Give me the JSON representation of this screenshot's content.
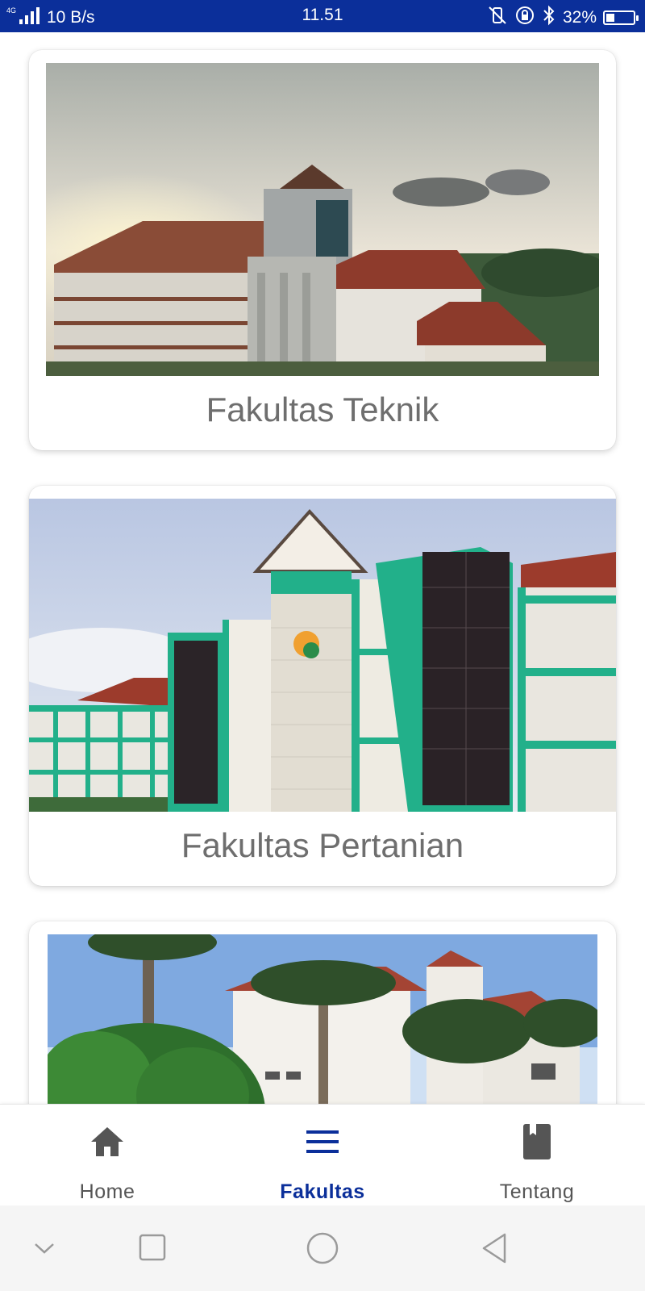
{
  "status_bar": {
    "signal": "4G",
    "net_speed": "10 B/s",
    "time": "11.51",
    "battery": "32%",
    "battery_level": 0.32,
    "icons": [
      "signal-icon",
      "mute-vibrate-icon",
      "rotation-lock-icon",
      "bluetooth-icon",
      "battery-icon"
    ]
  },
  "faculties": [
    {
      "name": "Fakultas Teknik",
      "image": "engineering-building-photo"
    },
    {
      "name": "Fakultas Pertanian",
      "image": "agriculture-building-photo"
    },
    {
      "name": "",
      "image": "faculty-building-photo"
    }
  ],
  "bottom_nav": {
    "items": [
      {
        "label": "Home",
        "icon": "home-icon",
        "active": false
      },
      {
        "label": "Fakultas",
        "icon": "menu-icon",
        "active": true
      },
      {
        "label": "Tentang",
        "icon": "book-icon",
        "active": false
      }
    ]
  },
  "system_nav": [
    "collapse-icon",
    "recents-icon",
    "home-circle-icon",
    "back-icon"
  ],
  "colors": {
    "primary": "#0b2f9a",
    "card_title": "#6e6e6e",
    "nav_inactive": "#555555",
    "teal_building": "#22b08a"
  }
}
